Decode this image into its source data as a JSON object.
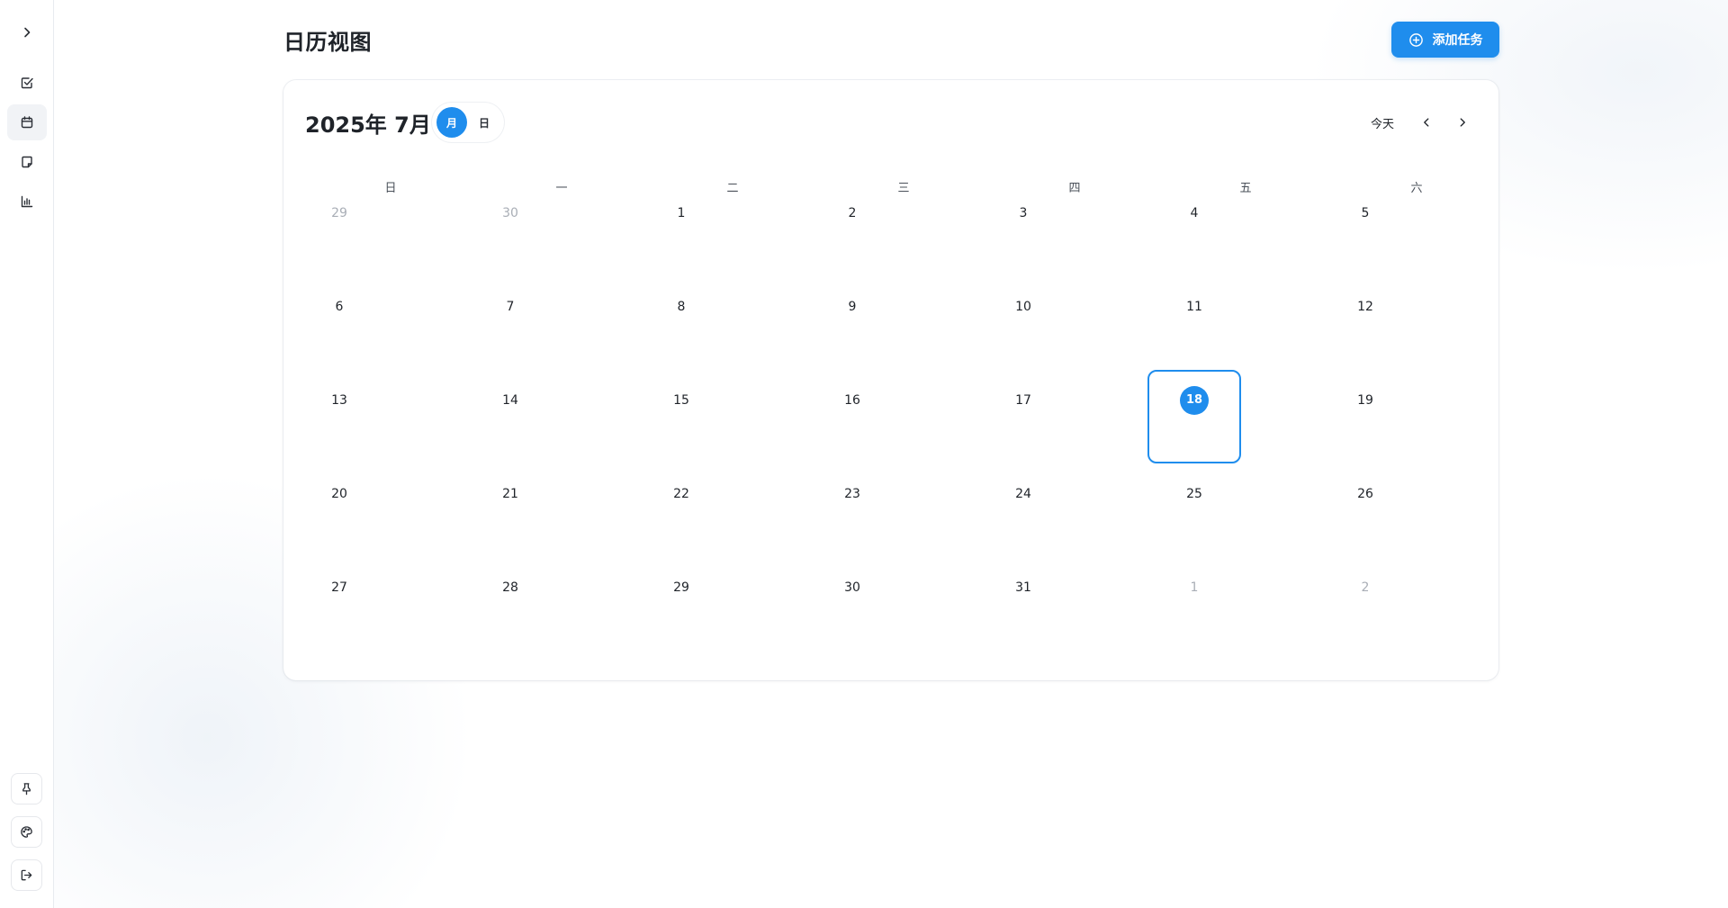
{
  "sidebar": {
    "expand_icon": "chevron-right-icon",
    "items": [
      {
        "name": "tasks",
        "icon": "checkbox-icon"
      },
      {
        "name": "calendar",
        "icon": "calendar-icon",
        "active": true
      },
      {
        "name": "notes",
        "icon": "note-icon"
      },
      {
        "name": "stats",
        "icon": "bar-chart-icon"
      }
    ],
    "bottom": [
      {
        "name": "pin",
        "icon": "pin-icon"
      },
      {
        "name": "theme",
        "icon": "palette-icon"
      },
      {
        "name": "logout",
        "icon": "logout-icon"
      }
    ]
  },
  "header": {
    "title": "日历视图",
    "add_button_label": "添加任务",
    "add_button_icon": "plus-circle-icon"
  },
  "calendar": {
    "month_title": "2025年 7月",
    "view_month_label": "月",
    "view_day_label": "日",
    "today_label": "今天",
    "weekdays": [
      "日",
      "一",
      "二",
      "三",
      "四",
      "五",
      "六"
    ],
    "weeks": [
      [
        {
          "day": "29",
          "muted": true
        },
        {
          "day": "30",
          "muted": true
        },
        {
          "day": "1"
        },
        {
          "day": "2"
        },
        {
          "day": "3"
        },
        {
          "day": "4"
        },
        {
          "day": "5"
        }
      ],
      [
        {
          "day": "6"
        },
        {
          "day": "7"
        },
        {
          "day": "8"
        },
        {
          "day": "9"
        },
        {
          "day": "10"
        },
        {
          "day": "11"
        },
        {
          "day": "12"
        }
      ],
      [
        {
          "day": "13"
        },
        {
          "day": "14"
        },
        {
          "day": "15"
        },
        {
          "day": "16"
        },
        {
          "day": "17"
        },
        {
          "day": "18",
          "today": true
        },
        {
          "day": "19"
        }
      ],
      [
        {
          "day": "20"
        },
        {
          "day": "21"
        },
        {
          "day": "22"
        },
        {
          "day": "23"
        },
        {
          "day": "24"
        },
        {
          "day": "25"
        },
        {
          "day": "26"
        }
      ],
      [
        {
          "day": "27"
        },
        {
          "day": "28"
        },
        {
          "day": "29"
        },
        {
          "day": "30"
        },
        {
          "day": "31"
        },
        {
          "day": "1",
          "muted": true
        },
        {
          "day": "2",
          "muted": true
        }
      ]
    ]
  },
  "colors": {
    "accent": "#1f8ded",
    "muted_text": "#a9aeb6",
    "text": "#1f2329"
  }
}
